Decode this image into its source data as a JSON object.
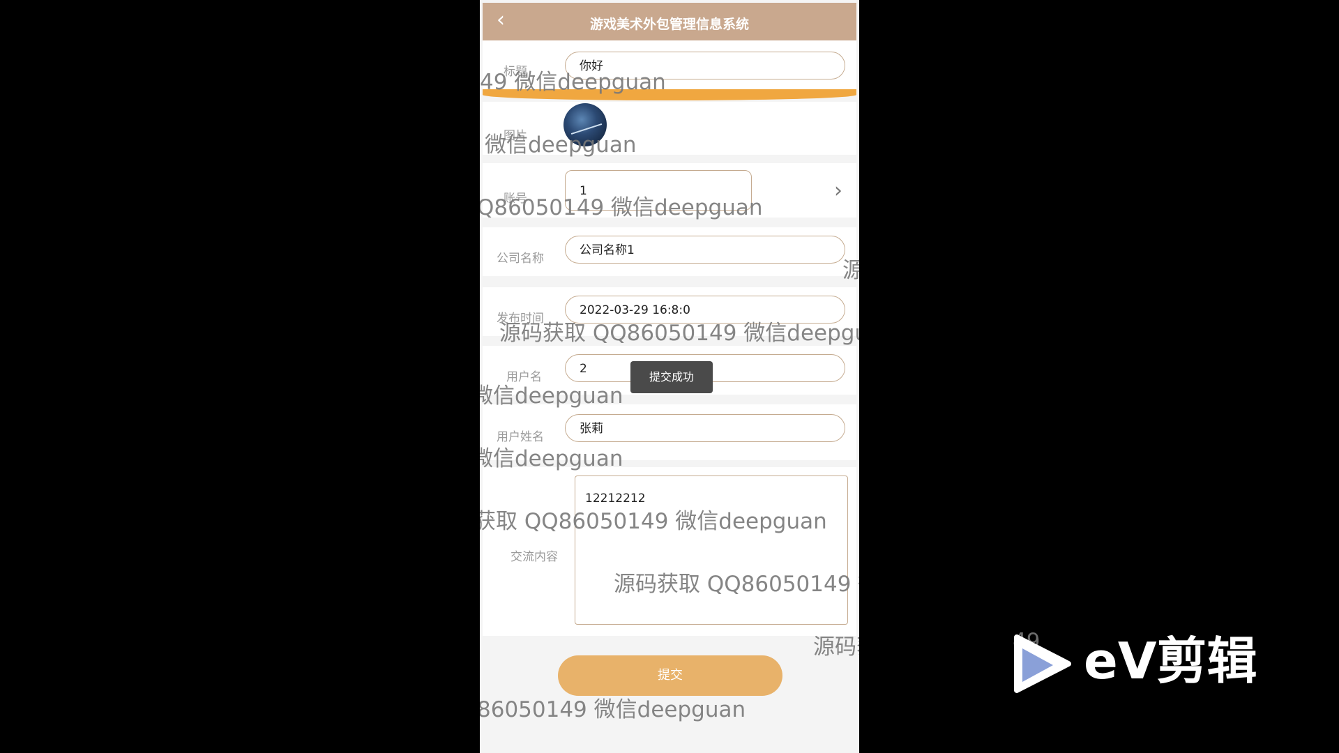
{
  "header": {
    "title": "游戏美术外包管理信息系统"
  },
  "form": {
    "title_label": "标题",
    "title_value": "你好",
    "image_label": "图片",
    "account_label": "账号",
    "account_value": "1",
    "company_label": "公司名称",
    "company_value": "公司名称1",
    "publish_time_label": "发布时间",
    "publish_time_value": "2022-03-29 16:8:0",
    "username_label": "用户名",
    "username_value": "2",
    "user_realname_label": "用户姓名",
    "user_realname_value": "张莉",
    "content_label": "交流内容",
    "content_value": "12212212"
  },
  "submit_label": "提交",
  "toast_message": "提交成功",
  "watermarks": [
    "49 微信deepguan",
    "微信deepguan",
    "Q86050149 微信deepguan",
    "源",
    "源码获取 QQ86050149 微信deepgua",
    "微信deepguan",
    "微信deepguan",
    "获取 QQ86050149 微信deepguan",
    "源码获取 QQ86050149 微",
    "源码获",
    "86050149 微信deepguan",
    "49"
  ],
  "logo": {
    "text": "eV剪辑"
  },
  "colors": {
    "header": "#c9a88e",
    "accent_orange": "#f0a740",
    "submit": "#e8b26a",
    "field_border": "#c5ab90"
  }
}
